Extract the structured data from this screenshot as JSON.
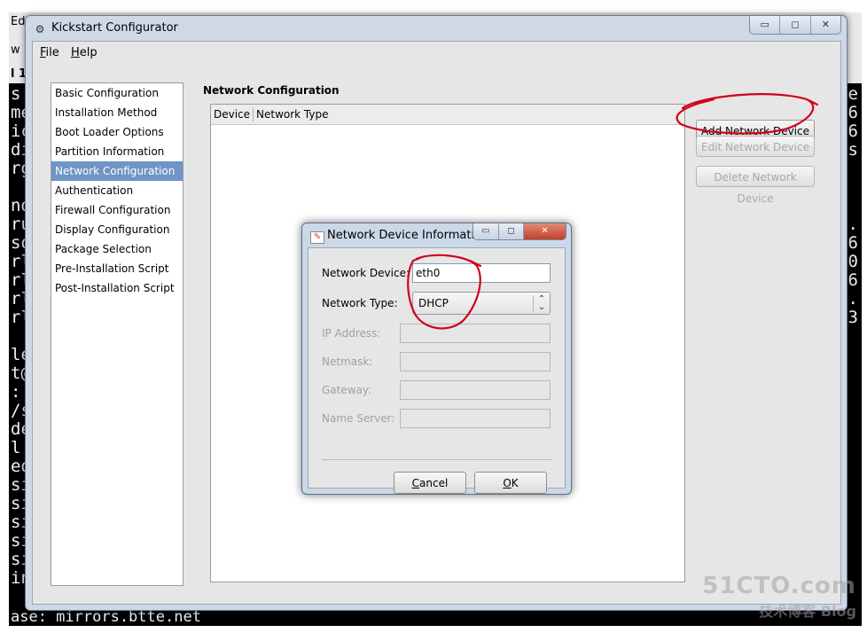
{
  "terminal": {
    "left_top_texts": [
      "Ed",
      "w",
      "l 1"
    ],
    "left_lines": [
      "s.",
      "me",
      "ic",
      "di",
      "rg",
      "",
      "nd",
      "ru",
      "sq",
      "rl",
      "rl",
      "rl",
      "rl",
      "",
      "le",
      "t@",
      ":",
      "/s",
      "de",
      "l",
      "ed",
      "si",
      "si",
      "si",
      "si",
      "si",
      "in"
    ],
    "right_lines": [
      "le",
      "6",
      "16",
      "is",
      "",
      "",
      "",
      "1.",
      "16",
      "0",
      "36",
      "1.",
      "13"
    ],
    "bottom_line": "ase: mirrors.btte.net"
  },
  "main_window": {
    "title": "Kickstart Configurator",
    "title_icon": "kickstart-app-icon",
    "controls": [
      "▭",
      "◻",
      "✕"
    ],
    "menu": [
      {
        "underline": "F",
        "rest": "ile"
      },
      {
        "underline": "H",
        "rest": "elp"
      }
    ],
    "nav": [
      "Basic Configuration",
      "Installation Method",
      "Boot Loader Options",
      "Partition Information",
      "Network Configuration",
      "Authentication",
      "Firewall Configuration",
      "Display Configuration",
      "Package Selection",
      "Pre-Installation Script",
      "Post-Installation Script"
    ],
    "selected_nav": "Network Configuration",
    "section_title": "Network Configuration",
    "table_columns": [
      "Device",
      "Network Type"
    ],
    "buttons": {
      "add": "Add Network Device",
      "edit": "Edit Network Device",
      "delete": "Delete Network Device"
    }
  },
  "dialog": {
    "title": "Network Device Information",
    "controls": [
      "▭",
      "◻",
      "✕"
    ],
    "network_device_label": "Network Device:",
    "network_device_value": "eth0",
    "network_type_label": "Network Type:",
    "network_type_value": "DHCP",
    "ip_label": "IP Address:",
    "netmask_label": "Netmask:",
    "gateway_label": "Gateway:",
    "nameserver_label": "Name Server:",
    "cancel": {
      "underline": "C",
      "rest": "ancel"
    },
    "ok": {
      "underline": "O",
      "rest": "K"
    }
  },
  "watermark": {
    "line1": "51CTO.com",
    "line2": "技术博客 Blog"
  },
  "colors": {
    "selection": "#6f95c5",
    "annotation": "#d0021b",
    "window_frame": "#cfd9e6"
  }
}
